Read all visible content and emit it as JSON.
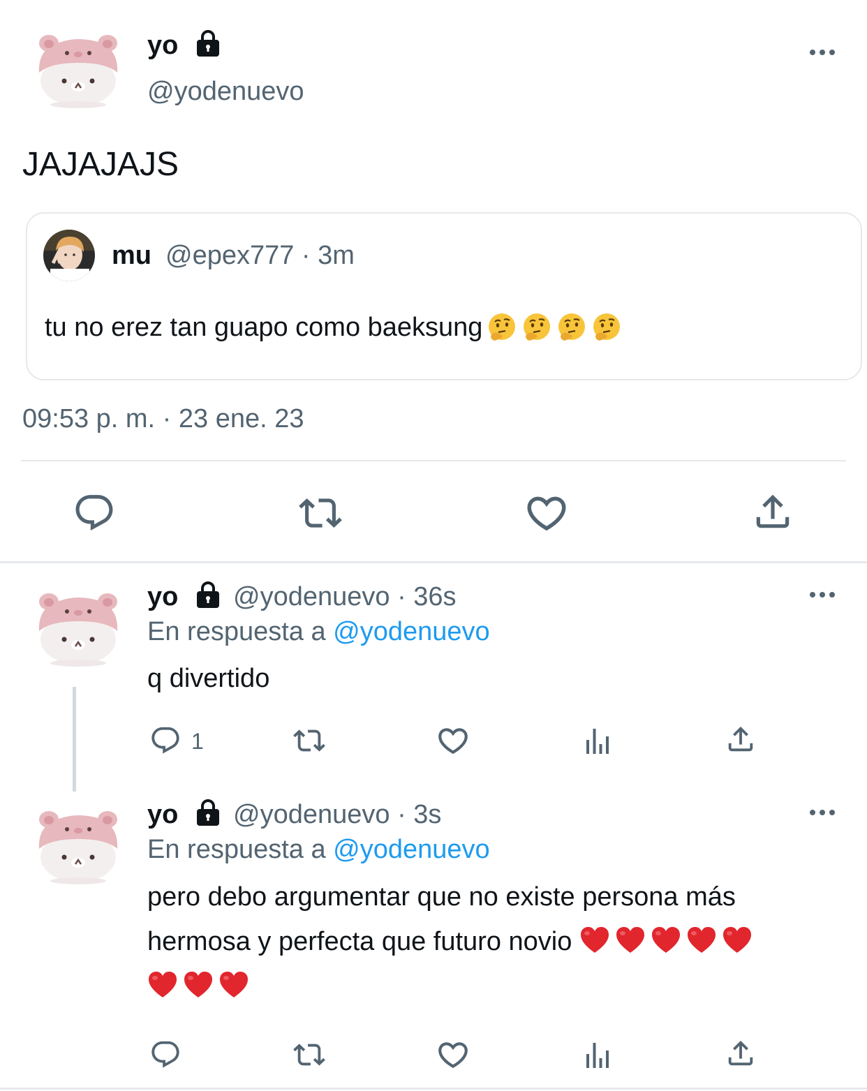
{
  "main_tweet": {
    "author_name": "yo",
    "author_handle": "@yodenuevo",
    "text": "JAJAJAJS",
    "timestamp": "09:53 p. m. · 23 ene. 23"
  },
  "quoted_tweet": {
    "author_name": "mu",
    "meta": "@epex777 · 3m",
    "text": "tu no erez tan guapo como baeksung",
    "emoji_count": 4
  },
  "reply_1": {
    "author_name": "yo",
    "meta": "@yodenuevo · 36s",
    "reply_prefix": "En respuesta a ",
    "reply_mention": "@yodenuevo",
    "text": "q divertido",
    "reply_count": "1"
  },
  "reply_2": {
    "author_name": "yo",
    "meta": "@yodenuevo · 3s",
    "reply_prefix": "En respuesta a ",
    "reply_mention": "@yodenuevo",
    "line1": "pero debo argumentar que no existe persona más",
    "line2": "hermosa y perfecta que futuro novio",
    "heart_count_line2": 5,
    "heart_count_line3": 3
  },
  "colors": {
    "text": "#0f1419",
    "secondary": "#536471",
    "link": "#1d9bf0",
    "divider": "#e6e9ec",
    "icon": "#536471"
  }
}
